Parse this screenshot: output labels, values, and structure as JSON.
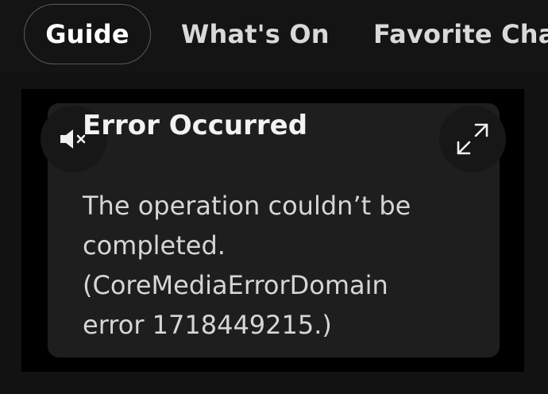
{
  "tabs": [
    {
      "label": "Guide",
      "active": true
    },
    {
      "label": "What's On",
      "active": false
    },
    {
      "label": "Favorite Chan",
      "active": false
    }
  ],
  "player": {
    "mute_icon": "speaker-muted-icon",
    "expand_icon": "expand-icon"
  },
  "error": {
    "title": "Error Occurred",
    "message": "The operation couldn’t be completed. (CoreMediaErrorDomain error 1718449215.)"
  },
  "colors": {
    "background": "#121212",
    "dialog": "#1e1e1e",
    "player": "#000000",
    "text": "#f2f2f2"
  }
}
